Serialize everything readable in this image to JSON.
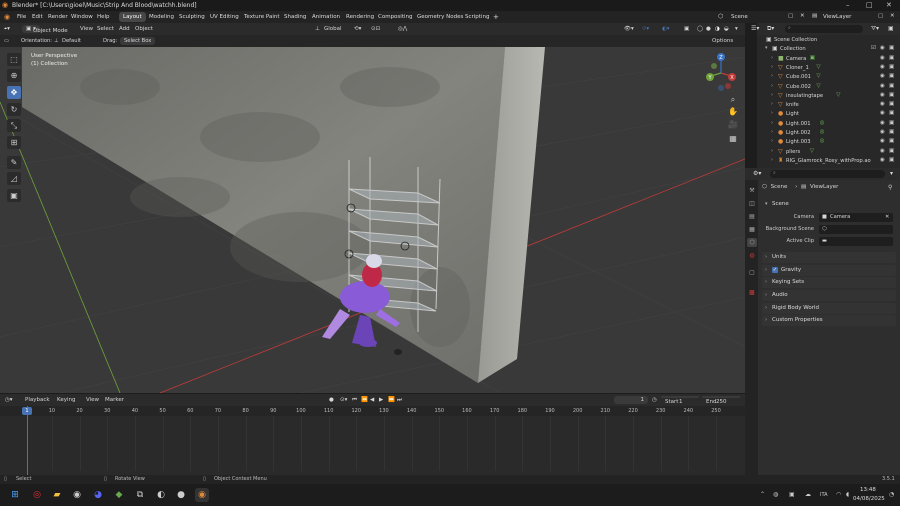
{
  "title_bar": {
    "title": "Blender* [C:\\Users\\gioel\\Music\\Strip And Blood\\watchh.blend]"
  },
  "menu": [
    "File",
    "Edit",
    "Render",
    "Window",
    "Help"
  ],
  "workspaces": [
    "Layout",
    "Modeling",
    "Sculpting",
    "UV Editing",
    "Texture Paint",
    "Shading",
    "Animation",
    "Rendering",
    "Compositing",
    "Geometry Nodes",
    "Scripting"
  ],
  "active_workspace": "Layout",
  "add_workspace": "+",
  "scene_selector": "Scene",
  "viewlayer_selector": "ViewLayer",
  "viewport_header": {
    "mode": "Object Mode",
    "items": [
      "View",
      "Select",
      "Add",
      "Object"
    ],
    "transform": "Global"
  },
  "tool_header": {
    "orientation_label": "Orientation:",
    "orientation_value": "Default",
    "drag_label": "Drag:",
    "drag_value": "Select Box",
    "options": "Options"
  },
  "viewport_info": {
    "line1": "User Perspective",
    "line2": "(1) Collection"
  },
  "gizmo": {
    "x": "X",
    "y": "Y",
    "z": "Z"
  },
  "outliner": {
    "search_placeholder": "",
    "rows": [
      {
        "name": "Scene Collection",
        "icon": "▣",
        "level": 0,
        "color": "#d6d6d6"
      },
      {
        "name": "Collection",
        "icon": "▣",
        "level": 1,
        "color": "#d6d6d6"
      },
      {
        "name": "Camera",
        "icon": "■",
        "level": 2,
        "color": "#8fb36f",
        "extra": "▣"
      },
      {
        "name": "Cloner_1",
        "icon": "▽",
        "level": 2,
        "color": "#e08a3b",
        "extra": "▽"
      },
      {
        "name": "Cube.001",
        "icon": "▽",
        "level": 2,
        "color": "#e08a3b",
        "extra": "▽"
      },
      {
        "name": "Cube.002",
        "icon": "▽",
        "level": 2,
        "color": "#e08a3b",
        "extra": "▽"
      },
      {
        "name": "insulatingtape",
        "icon": "▽",
        "level": 2,
        "color": "#e08a3b",
        "extra": "▽"
      },
      {
        "name": "knife",
        "icon": "▽",
        "level": 2,
        "color": "#e08a3b",
        "extra": ""
      },
      {
        "name": "Light",
        "icon": "●",
        "level": 2,
        "color": "#e08a3b",
        "extra": ""
      },
      {
        "name": "Light.001",
        "icon": "●",
        "level": 2,
        "color": "#e08a3b",
        "extra": "◎"
      },
      {
        "name": "Light.002",
        "icon": "●",
        "level": 2,
        "color": "#e08a3b",
        "extra": "◎"
      },
      {
        "name": "Light.003",
        "icon": "●",
        "level": 2,
        "color": "#e08a3b",
        "extra": "◎"
      },
      {
        "name": "pliers",
        "icon": "▽",
        "level": 2,
        "color": "#e08a3b",
        "extra": "▽"
      },
      {
        "name": "RIG_Glamrock_Roxy_withProp.ao",
        "icon": "♜",
        "level": 2,
        "color": "#e08a3b",
        "extra": ""
      }
    ]
  },
  "properties": {
    "breadcrumb": {
      "scene": "Scene",
      "viewlayer": "ViewLayer"
    },
    "scene_panel": "Scene",
    "camera_label": "Camera",
    "camera_value": "Camera",
    "background_scene_label": "Background Scene",
    "active_clip_label": "Active Clip",
    "sections": [
      "Units",
      "Gravity",
      "Keying Sets",
      "Audio",
      "Rigid Body World",
      "Custom Properties"
    ]
  },
  "timeline": {
    "menu": [
      "Playback",
      "Keying",
      "View",
      "Marker"
    ],
    "current_frame": "1",
    "start_label": "Start",
    "start_value": "1",
    "end_label": "End",
    "end_value": "250",
    "ticks": [
      "1",
      "10",
      "20",
      "30",
      "40",
      "50",
      "60",
      "70",
      "80",
      "90",
      "100",
      "110",
      "120",
      "130",
      "140",
      "150",
      "160",
      "170",
      "180",
      "190",
      "200",
      "210",
      "220",
      "230",
      "240",
      "250"
    ]
  },
  "status_bar": {
    "select": "Select",
    "rotate": "Rotate View",
    "context": "Object Context Menu",
    "version": "3.5.1"
  },
  "taskbar": {
    "time": "13:48",
    "date": "04/08/2025",
    "lang": "ITA"
  },
  "colors": {
    "accent": "#4772b3",
    "object_orange": "#e08a3b",
    "axis_red": "#c23b3b",
    "axis_green": "#6fa33a"
  }
}
